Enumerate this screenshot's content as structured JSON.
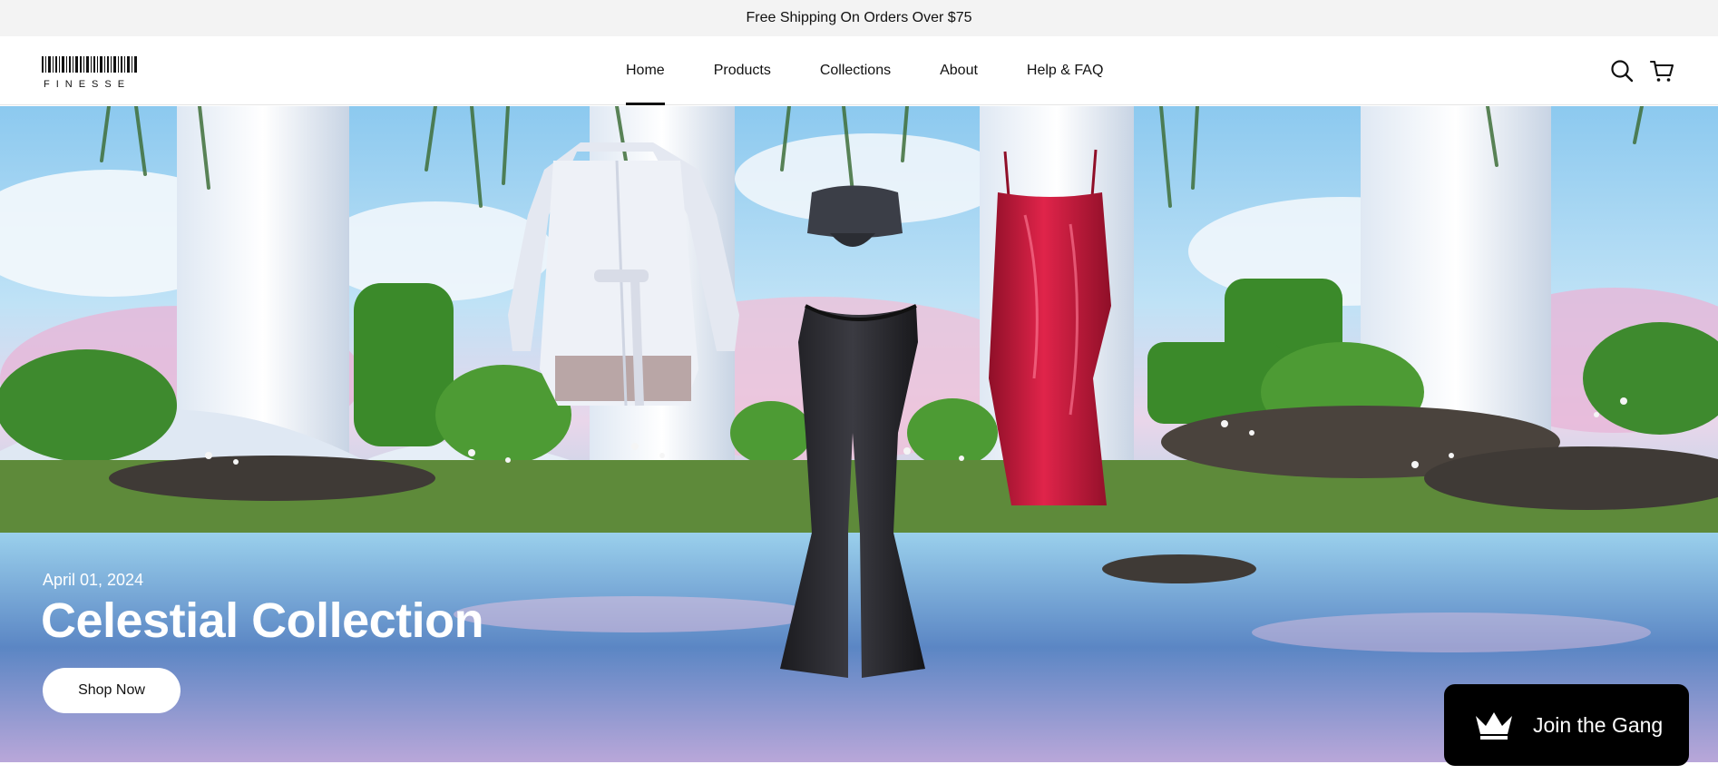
{
  "announcement": {
    "text": "Free Shipping On Orders Over $75"
  },
  "brand": {
    "name": "FINESSE",
    "logo_icon": "barcode-logo"
  },
  "nav": {
    "items": [
      {
        "label": "Home",
        "active": true
      },
      {
        "label": "Products",
        "active": false
      },
      {
        "label": "Collections",
        "active": false
      },
      {
        "label": "About",
        "active": false
      },
      {
        "label": "Help & FAQ",
        "active": false
      }
    ]
  },
  "header_icons": {
    "search": "search-icon",
    "cart": "cart-icon"
  },
  "hero": {
    "date": "April 01, 2024",
    "title": "Celestial Collection",
    "cta_label": "Shop Now",
    "image_alt_icon": "fashion-garden-scene"
  },
  "rewards_widget": {
    "label": "Join the Gang",
    "icon": "crown-icon"
  },
  "colors": {
    "announcement_bg": "#f3f3f3",
    "brand_dark": "#000000",
    "hero_text": "#ffffff",
    "dress_red": "#c8193a"
  }
}
